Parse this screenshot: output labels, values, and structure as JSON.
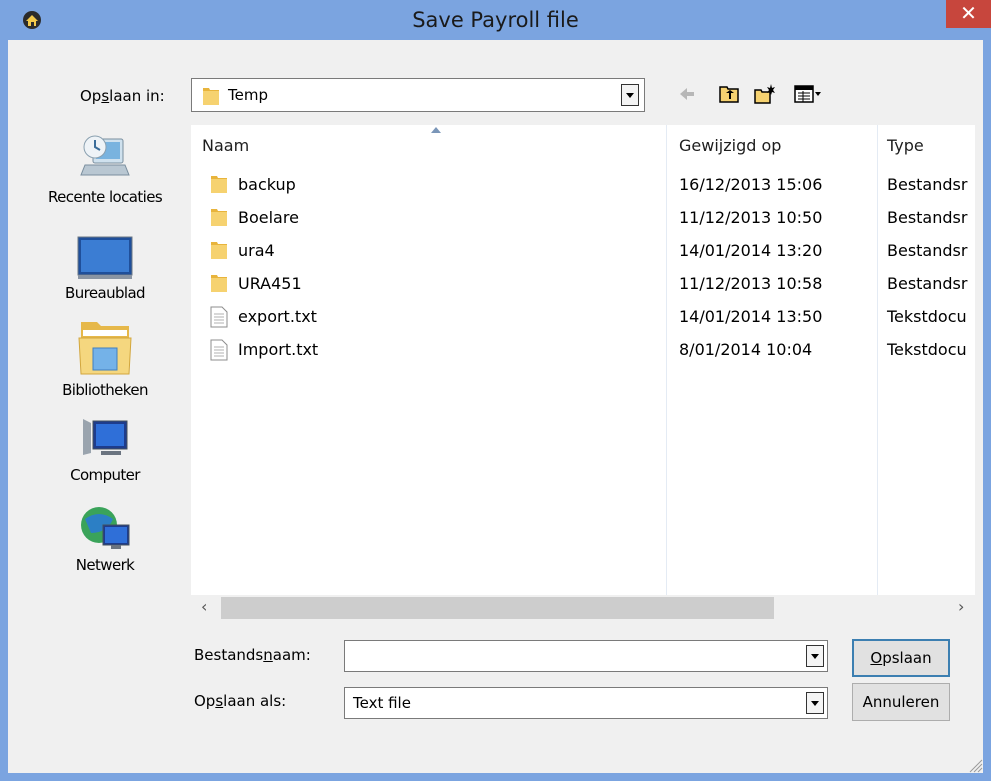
{
  "dialog": {
    "title": "Save Payroll file",
    "close_glyph": "✕",
    "accent_title": "#7ba4e0",
    "close_color": "#c7463d"
  },
  "lookin": {
    "label_pre": "Op",
    "label_u": "s",
    "label_post": "laan in:",
    "value": "Temp"
  },
  "toolbar": {
    "icons": [
      "back-arrow-icon",
      "up-folder-icon",
      "new-folder-icon",
      "view-menu-icon"
    ]
  },
  "places": [
    {
      "label": "Recente locaties",
      "icon": "recent-locations-icon"
    },
    {
      "label": "Bureaublad",
      "icon": "desktop-icon"
    },
    {
      "label": "Bibliotheken",
      "icon": "libraries-icon"
    },
    {
      "label": "Computer",
      "icon": "computer-icon"
    },
    {
      "label": "Netwerk",
      "icon": "network-icon"
    }
  ],
  "columns": {
    "name": "Naam",
    "modified": "Gewijzigd op",
    "type": "Type"
  },
  "files": [
    {
      "name": "backup",
      "modified": "16/12/2013 15:06",
      "type": "Bestandsr",
      "kind": "folder"
    },
    {
      "name": "Boelare",
      "modified": "11/12/2013 10:50",
      "type": "Bestandsr",
      "kind": "folder"
    },
    {
      "name": "ura4",
      "modified": "14/01/2014 13:20",
      "type": "Bestandsr",
      "kind": "folder"
    },
    {
      "name": "URA451",
      "modified": "11/12/2013 10:58",
      "type": "Bestandsr",
      "kind": "folder"
    },
    {
      "name": "export.txt",
      "modified": "14/01/2014 13:50",
      "type": "Tekstdocu",
      "kind": "text"
    },
    {
      "name": "Import.txt",
      "modified": "8/01/2014 10:04",
      "type": "Tekstdocu",
      "kind": "text"
    }
  ],
  "scroll": {
    "left_glyph": "‹",
    "right_glyph": "›"
  },
  "filename": {
    "label_pre": "Bestands",
    "label_u": "n",
    "label_post": "aam:",
    "value": ""
  },
  "saveas": {
    "label_pre": "Op",
    "label_u": "s",
    "label_post": "laan als:",
    "value": "Text file"
  },
  "buttons": {
    "save_u": "O",
    "save_rest": "pslaan",
    "cancel": "Annuleren"
  }
}
